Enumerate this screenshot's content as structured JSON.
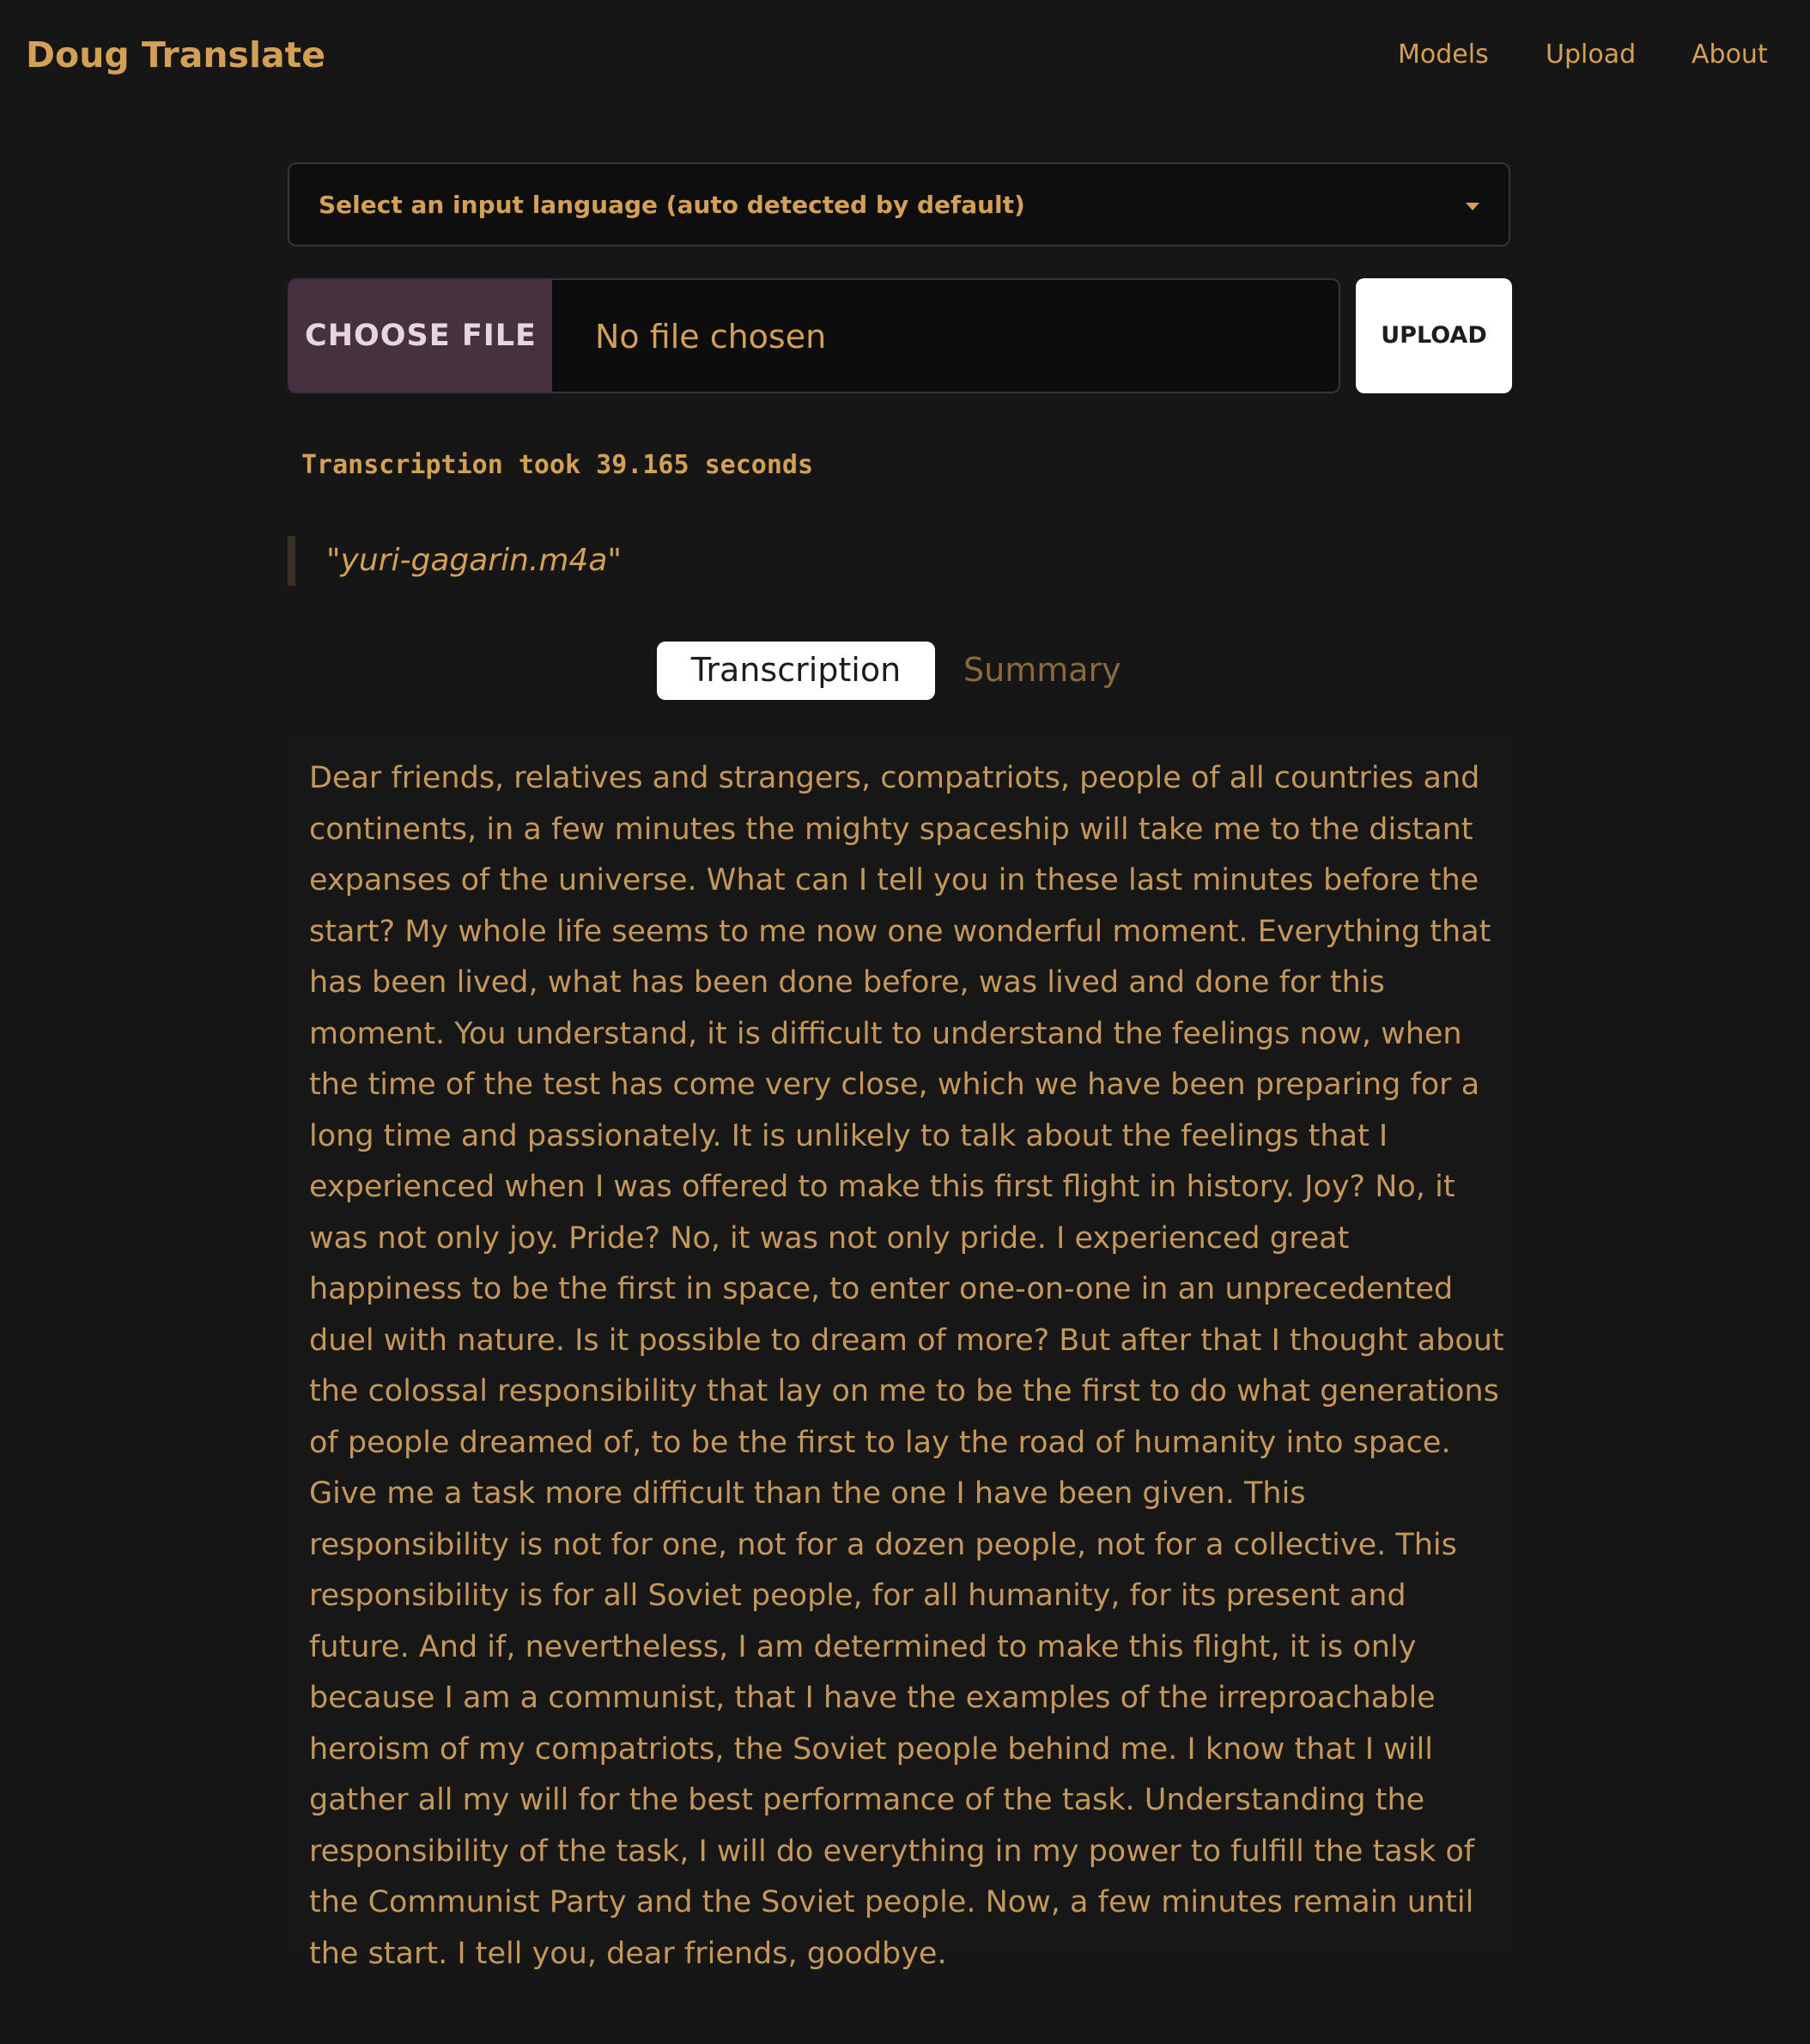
{
  "nav": {
    "brand": "Doug Translate",
    "links": [
      "Models",
      "Upload",
      "About"
    ]
  },
  "language_select": {
    "selected": "Select an input language (auto detected by default)",
    "icon": "chevron-down-icon"
  },
  "file_input": {
    "button_label": "CHOOSE FILE",
    "status": "No file chosen"
  },
  "upload_button": "UPLOAD",
  "timing": "Transcription took 39.165 seconds",
  "filename": "\"yuri-gagarin.m4a\"",
  "tabs": {
    "active": "Transcription",
    "items": [
      "Transcription",
      "Summary"
    ]
  },
  "transcription": "Dear friends, relatives and strangers, compatriots, people of all countries and continents, in a few minutes the mighty spaceship will take me to the distant expanses of the universe. What can I tell you in these last minutes before the start? My whole life seems to me now one wonderful moment. Everything that has been lived, what has been done before, was lived and done for this moment. You understand, it is difficult to understand the feelings now, when the time of the test has come very close, which we have been preparing for a long time and passionately. It is unlikely to talk about the feelings that I experienced when I was offered to make this first flight in history. Joy? No, it was not only joy. Pride? No, it was not only pride. I experienced great happiness to be the first in space, to enter one-on-one in an unprecedented duel with nature. Is it possible to dream of more? But after that I thought about the colossal responsibility that lay on me to be the first to do what generations of people dreamed of, to be the first to lay the road of humanity into space. Give me a task more difficult than the one I have been given. This responsibility is not for one, not for a dozen people, not for a collective. This responsibility is for all Soviet people, for all humanity, for its present and future. And if, nevertheless, I am determined to make this flight, it is only because I am a communist, that I have the examples of the irreproachable heroism of my compatriots, the Soviet people behind me. I know that I will gather all my will for the best performance of the task. Understanding the responsibility of the task, I will do everything in my power to fulfill the task of the Communist Party and the Soviet people. Now, a few minutes remain until the start. I tell you, dear friends, goodbye.",
  "colors": {
    "background": "#161616",
    "accent": "#d4a056",
    "file_button": "#46313f",
    "border": "#3f2e3c"
  }
}
